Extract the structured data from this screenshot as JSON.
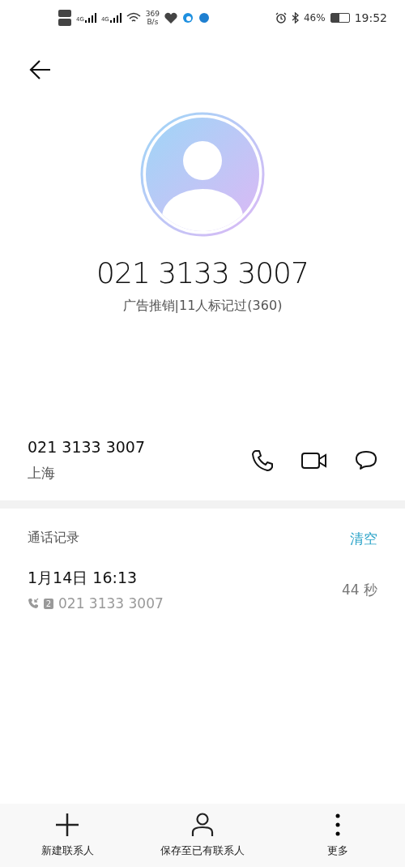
{
  "status_bar": {
    "sim_labels": [
      "4G",
      "4G"
    ],
    "net_speed": "369",
    "net_unit": "B/s",
    "battery_percent": "46%",
    "time": "19:52"
  },
  "header": {
    "number": "021 3133 3007",
    "tag": "广告推销|11人标记过(360)"
  },
  "contact": {
    "number": "021 3133 3007",
    "location": "上海"
  },
  "call_log": {
    "title": "通话记录",
    "clear": "清空",
    "entries": [
      {
        "date": "1月14日 16:13",
        "sim": "2",
        "number": "021 3133 3007",
        "duration": "44 秒"
      }
    ]
  },
  "bottom_actions": [
    {
      "kind": "add",
      "label": "新建联系人"
    },
    {
      "kind": "person",
      "label": "保存至已有联系人"
    },
    {
      "kind": "more",
      "label": "更多"
    }
  ]
}
